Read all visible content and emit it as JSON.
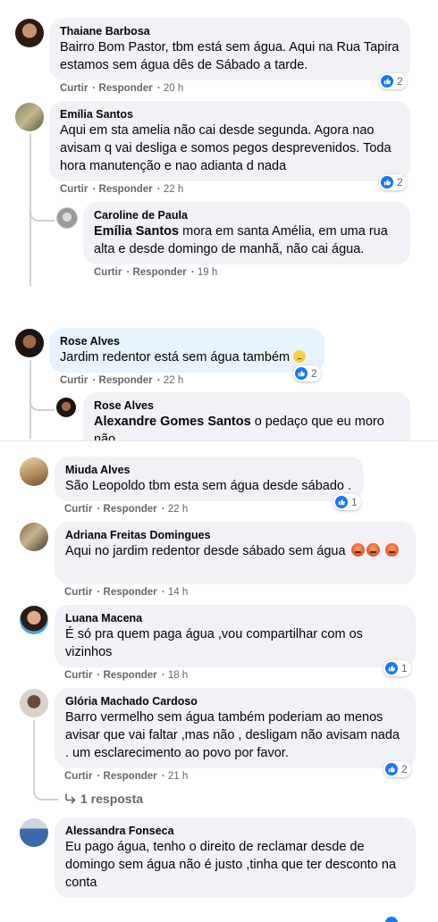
{
  "actions": {
    "like": "Curtir",
    "reply": "Responder"
  },
  "comments": [
    {
      "name": "Thaiane Barbosa",
      "text": "Bairro Bom Pastor, tbm está sem água. Aqui na Rua Tapira estamos sem água dês de Sábado a tarde.",
      "time": "20 h",
      "reactions": "2"
    },
    {
      "name": "Emília Santos",
      "text": "Aqui em sta amelia não cai desde segunda. Agora nao avisam q vai desliga e somos pegos desprevenidos. Toda hora manutenção e nao adianta d nada",
      "time": "22 h",
      "reactions": "2"
    },
    {
      "name": "Caroline de Paula",
      "mention": "Emília Santos",
      "text": " mora em santa Amélia, em uma rua alta e desde domingo de manhã, não cai água.",
      "time": "19 h"
    },
    {
      "name": "Rose Alves",
      "text": "Jardim redentor está sem água também",
      "time": "22 h",
      "reactions": "2"
    },
    {
      "name": "Rose Alves",
      "mention": "Alexandre Gomes Santos",
      "text": " o pedaço que eu moro não",
      "time": ""
    },
    {
      "name": "Miuda Alves",
      "text": "São Leopoldo tbm esta sem água desde sábado .",
      "time": "22 h",
      "reactions": "1"
    },
    {
      "name": "Adriana Freitas Domingues",
      "text": "Aqui no jardim redentor desde sábado sem água",
      "time": "14 h"
    },
    {
      "name": "Luana Macena",
      "text": "É só pra quem paga água ,vou compartilhar com os vizinhos",
      "time": "18 h",
      "reactions": "1"
    },
    {
      "name": "Glória Machado Cardoso",
      "text": "Barro vermelho sem água também poderiam ao menos avisar que vai faltar ,mas não , desligam não avisam nada . um esclarecimento ao povo por favor.",
      "time": "21 h",
      "reactions": "2",
      "replies": "1 resposta"
    },
    {
      "name": "Alessandra Fonseca",
      "text": "Eu pago água, tenho o direito de reclamar desde de domingo sem água não é justo ,tinha que ter desconto na conta",
      "time": ""
    }
  ]
}
